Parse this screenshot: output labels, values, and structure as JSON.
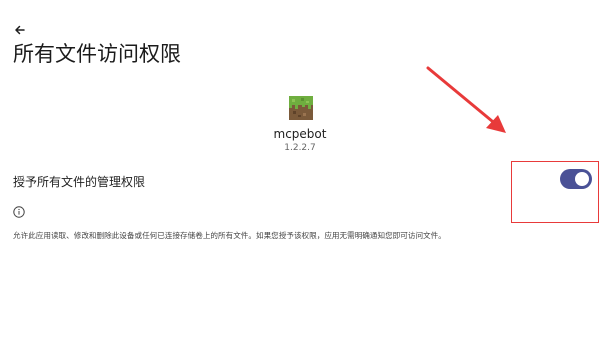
{
  "header": {
    "back_icon": "back-arrow-icon",
    "title": "所有文件访问权限"
  },
  "app": {
    "icon": "minecraft-grass-block-icon",
    "name": "mcpebot",
    "version": "1.2.2.7"
  },
  "permission": {
    "label": "授予所有文件的管理权限",
    "toggle_on": true
  },
  "info": {
    "icon": "info-icon",
    "description": "允许此应用读取、修改和删除此设备或任何已连接存储卷上的所有文件。如果您授予该权限，应用无需明确通知您即可访问文件。"
  },
  "colors": {
    "toggle_track": "#4a5196",
    "toggle_thumb": "#ffffff",
    "annotation": "#e83a3a"
  }
}
